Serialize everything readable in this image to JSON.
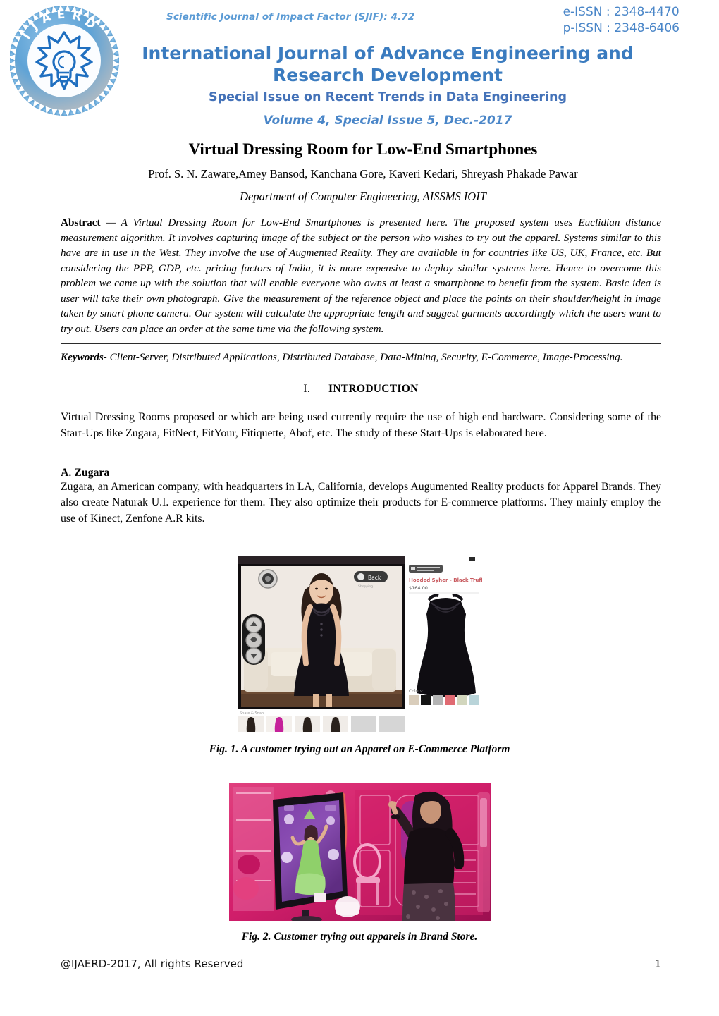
{
  "masthead": {
    "logo_alt": "IJAERD logo",
    "logo_ring_text": "IJAERD",
    "sjif": "Scientific Journal of Impact Factor (SJIF): 4.72",
    "eissn": "e-ISSN : 2348-4470",
    "pissn": "p-ISSN : 2348-6406",
    "journal_title": "International Journal of Advance Engineering and Research Development",
    "special_issue": "Special Issue on Recent Trends in Data Engineering",
    "volume_line": "Volume 4, Special Issue 5, Dec.-2017",
    "colors": {
      "journal_title": "#3a7bbf",
      "special_issue": "#4472b8",
      "volume_line": "#4a86c8",
      "sjif": "#5b9bd5",
      "issn": "#4a86c8"
    }
  },
  "title_block": {
    "paper_title": "Virtual Dressing Room for Low-End Smartphones",
    "authors": "Prof. S. N. Zaware,Amey Bansod, Kanchana Gore, Kaveri Kedari, Shreyash Phakade Pawar",
    "affiliation": "Department of Computer Engineering, AISSMS IOIT"
  },
  "abstract": {
    "label": "Abstract",
    "dash": " — ",
    "text": "A Virtual Dressing Room for Low-End Smartphones is presented here. The proposed system uses Euclidian distance measurement algorithm. It involves capturing image of the subject or the person who wishes to try out the apparel. Systems similar to this have are in use in the West. They involve the use of Augmented Reality. They are available in for countries like US, UK, France, etc. But considering the PPP, GDP, etc. pricing factors of India, it is more expensive to deploy similar systems here. Hence to overcome this problem we came up with the solution that will enable everyone who owns at least a smartphone to benefit from the system. Basic idea is user will take their own photograph. Give the measurement of the reference object and place the points on their shoulder/height in image taken by smart phone camera. Our system will calculate the appropriate length and suggest garments accordingly which the users want to try out. Users can place an order at the same time via the following system."
  },
  "keywords": {
    "label": "Keywords-",
    "text": " Client-Server, Distributed Applications, Distributed Database, Data-Mining, Security, E-Commerce, Image-Processing."
  },
  "sections": [
    {
      "number": "I.",
      "heading": "INTRODUCTION",
      "paragraphs": [
        "Virtual Dressing Rooms proposed or which are being used currently require the use of high end hardware. Considering some of the Start-Ups like Zugara, FitNect, FitYour, Fitiquette, Abof, etc. The study of these Start-Ups is elaborated here."
      ],
      "subsections": [
        {
          "heading": "A. Zugara",
          "paragraphs": [
            "Zugara, an American company, with headquarters in LA, California, develops Augumented Reality products for Apparel Brands. They also create Naturak U.I. experience for them. They also optimize their products for E-commerce platforms. They mainly employ the use of Kinect, Zenfone A.R kits."
          ]
        }
      ]
    }
  ],
  "figures": [
    {
      "id": "fig-1",
      "caption": "Fig. 1. A customer trying out an Apparel on E-Commerce Platform",
      "alt": "Screenshot of a virtual dressing room web application: a woman in a black dress stands in front of a sofa on the left camera panel with circular control buttons; the right panel shows the product photo, name and price with color swatches; a thumbnail strip runs along the bottom.",
      "overlay_texts": {
        "product_name": "Hooded Syher - Black Truffle",
        "price": "$164.00",
        "colors_label": "Colors:",
        "share_label": "Share & Snap",
        "back_button": "Back"
      },
      "swatches": [
        "#d9cdbb",
        "#141414",
        "#b4b4b4",
        "#e06a72",
        "#d2d6bd",
        "#b9d4d9"
      ]
    },
    {
      "id": "fig-2",
      "caption": "Fig. 2. Customer trying out apparels in Brand Store.",
      "alt": "Photo of a woman in a pink-lit brand store raising her arm in front of a large magic-mirror display that shows her wearing a green virtual dress; pink shelving, a pink chair and cabinets fill the background."
    }
  ],
  "footer": {
    "copyright": "@IJAERD-2017, All rights Reserved",
    "page_number": "1"
  }
}
